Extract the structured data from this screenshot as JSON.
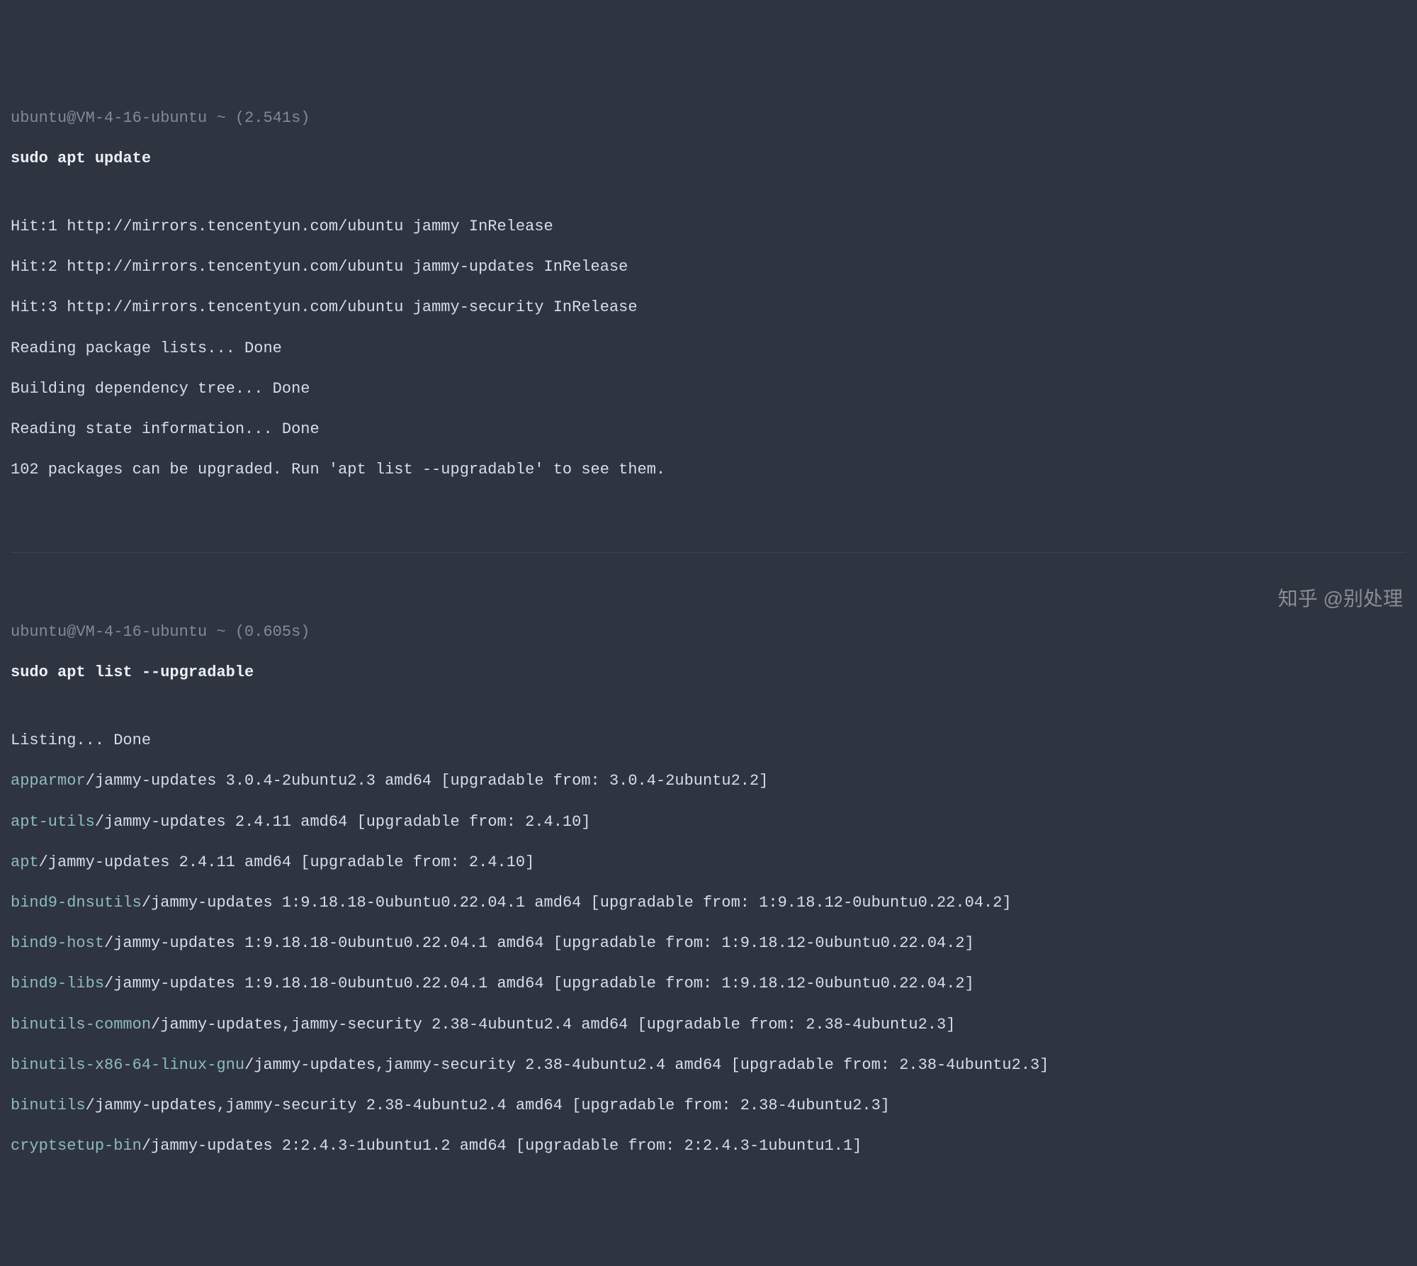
{
  "block1": {
    "prompt": "ubuntu@VM-4-16-ubuntu ~ (2.541s)",
    "command": "sudo apt update",
    "output": [
      "Hit:1 http://mirrors.tencentyun.com/ubuntu jammy InRelease",
      "Hit:2 http://mirrors.tencentyun.com/ubuntu jammy-updates InRelease",
      "Hit:3 http://mirrors.tencentyun.com/ubuntu jammy-security InRelease",
      "Reading package lists... Done",
      "Building dependency tree... Done",
      "Reading state information... Done",
      "102 packages can be upgraded. Run 'apt list --upgradable' to see them."
    ]
  },
  "block2": {
    "prompt": "ubuntu@VM-4-16-ubuntu ~ (0.605s)",
    "command": "sudo apt list --upgradable",
    "listing_header": "Listing... Done",
    "packages": [
      {
        "name": "apparmor",
        "rest": "/jammy-updates 3.0.4-2ubuntu2.3 amd64 [upgradable from: 3.0.4-2ubuntu2.2]"
      },
      {
        "name": "apt-utils",
        "rest": "/jammy-updates 2.4.11 amd64 [upgradable from: 2.4.10]"
      },
      {
        "name": "apt",
        "rest": "/jammy-updates 2.4.11 amd64 [upgradable from: 2.4.10]"
      },
      {
        "name": "bind9-dnsutils",
        "rest": "/jammy-updates 1:9.18.18-0ubuntu0.22.04.1 amd64 [upgradable from: 1:9.18.12-0ubuntu0.22.04.2]"
      },
      {
        "name": "bind9-host",
        "rest": "/jammy-updates 1:9.18.18-0ubuntu0.22.04.1 amd64 [upgradable from: 1:9.18.12-0ubuntu0.22.04.2]"
      },
      {
        "name": "bind9-libs",
        "rest": "/jammy-updates 1:9.18.18-0ubuntu0.22.04.1 amd64 [upgradable from: 1:9.18.12-0ubuntu0.22.04.2]"
      },
      {
        "name": "binutils-common",
        "rest": "/jammy-updates,jammy-security 2.38-4ubuntu2.4 amd64 [upgradable from: 2.38-4ubuntu2.3]"
      },
      {
        "name": "binutils-x86-64-linux-gnu",
        "rest": "/jammy-updates,jammy-security 2.38-4ubuntu2.4 amd64 [upgradable from: 2.38-4ubuntu2.3]"
      },
      {
        "name": "binutils",
        "rest": "/jammy-updates,jammy-security 2.38-4ubuntu2.4 amd64 [upgradable from: 2.38-4ubuntu2.3]"
      },
      {
        "name": "cryptsetup-bin",
        "rest": "/jammy-updates 2:2.4.3-1ubuntu1.2 amd64 [upgradable from: 2:2.4.3-1ubuntu1.1]"
      }
    ]
  },
  "watermark": "知乎 @别处理"
}
